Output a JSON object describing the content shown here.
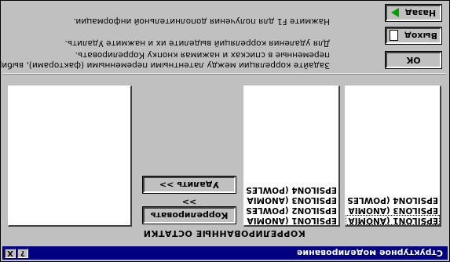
{
  "window": {
    "title": "Структурное моделирование",
    "help_button": "?",
    "close_button": "X"
  },
  "caption": "КОРРЕЛИРОВАННЫЕ ОСТАТКИ",
  "list_left": {
    "items": [
      "EPSILON1 (ANOMIA",
      "EPSILON3 (ANOMIA",
      "EPSILON4 (POWLES"
    ]
  },
  "list_middle": {
    "items": [
      "EPSILON1 (ANOMIA",
      "EPSILON2 (POWLES",
      "EPSILON3 (ANOMIA",
      "EPSILON4 (POWLES"
    ]
  },
  "buttons": {
    "correlate": "Коррелировать >>",
    "delete": "Удалить >>",
    "ok": "ОК",
    "exit": "Выход",
    "back": "Назад"
  },
  "instructions": {
    "line1": "Задайте корреляции между латентными переменными (факторами), выбирая",
    "line2": "переменные в списках и нажимая кнопку Коррелировать.",
    "line3": "Для удаления корреляций выделите их и нажмите Удалить.",
    "line4": "Нажмите F1 для получения дополнительной информации."
  },
  "icons": {
    "back": "green-arrow-left-icon",
    "exit": "door-exit-icon"
  }
}
